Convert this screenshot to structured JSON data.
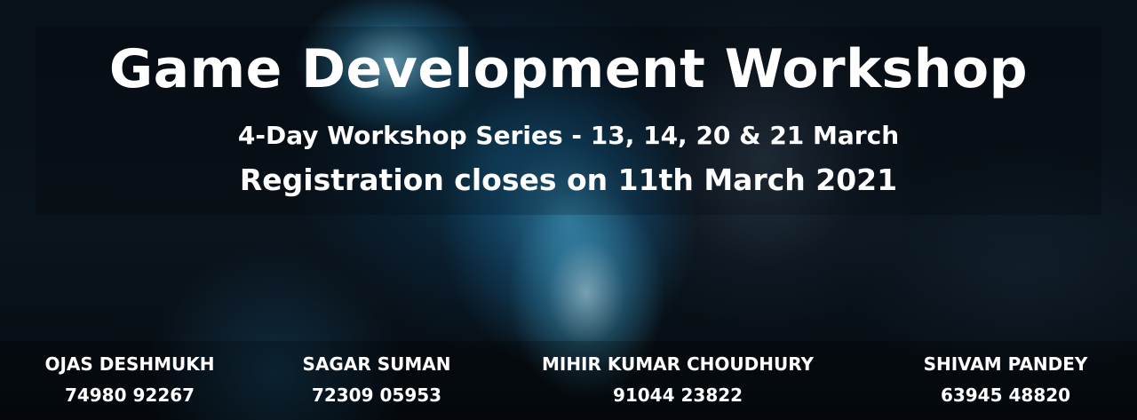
{
  "banner": {
    "title": "Game Development Workshop",
    "subtitle": "4-Day Workshop Series - 13, 14, 20 & 21 March",
    "deadline": "Registration closes on 11th March 2021"
  },
  "contacts": [
    {
      "name": "OJAS DESHMUKH",
      "phone": "74980 92267"
    },
    {
      "name": "SAGAR SUMAN",
      "phone": "72309 05953"
    },
    {
      "name": "MIHIR KUMAR CHOUDHURY",
      "phone": "91044 23822"
    },
    {
      "name": "SHIVAM PANDEY",
      "phone": "63945 48820"
    }
  ],
  "colors": {
    "text": "#ffffff",
    "background": "#05080c",
    "accent_glow": "#5ab8e0"
  }
}
